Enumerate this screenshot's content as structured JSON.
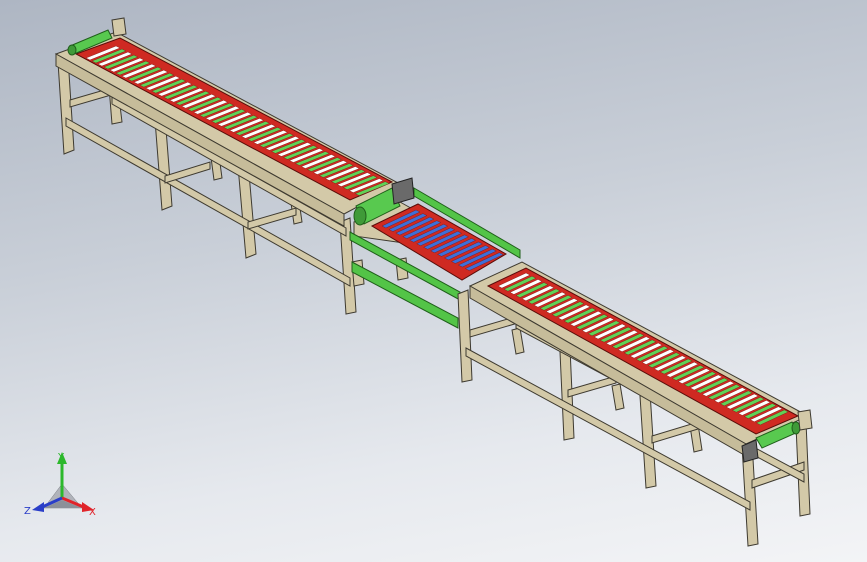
{
  "triad": {
    "x_label": "X",
    "y_label": "Y",
    "z_label": "Z",
    "colors": {
      "x": "#e0242a",
      "y": "#2cb82c",
      "z": "#2a3ec8"
    }
  },
  "colors": {
    "frame": "#d3c9a8",
    "frame_edge": "#3e3a30",
    "tray": "#cf2a22",
    "roller_white": "#ffffff",
    "roller_green": "#5fd257",
    "roller_blue": "#3d6fd9",
    "drive_roller": "#58c94f",
    "transfer_arm": "#53c447"
  }
}
